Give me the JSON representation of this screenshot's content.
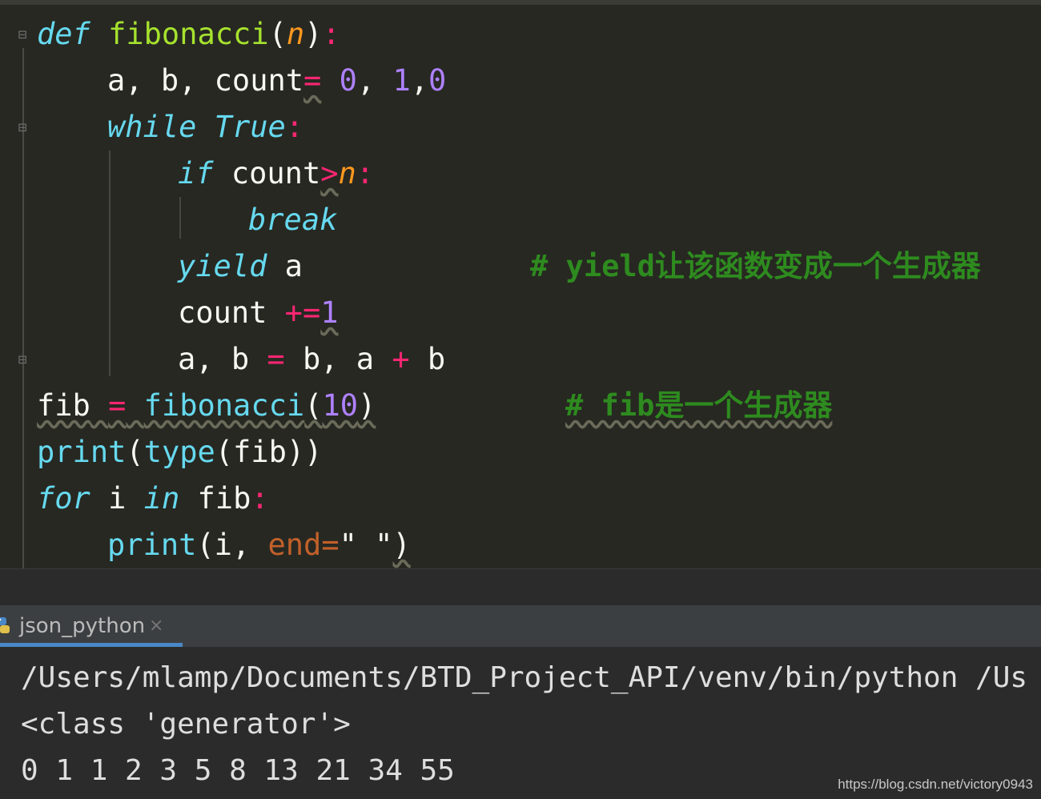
{
  "code": {
    "l1": {
      "kw": "def",
      "fn": "fibonacci",
      "open": "(",
      "param": "n",
      "close": ")",
      "colon": ":"
    },
    "l2": {
      "vars": "a, b, count",
      "eq": "=",
      "v0": "0",
      "c1": ", ",
      "v1": "1",
      "c2": ",",
      "v2": "0"
    },
    "l3": {
      "kw": "while",
      "val": "True",
      "colon": ":"
    },
    "l4": {
      "kw": "if",
      "var": "count",
      "op": ">",
      "param": "n",
      "colon": ":"
    },
    "l5": {
      "kw": "break"
    },
    "l6": {
      "kw": "yield",
      "var": "a",
      "comment": "# yield让该函数变成一个生成器"
    },
    "l7": {
      "var": "count",
      "op": "+=",
      "num": "1"
    },
    "l8": {
      "lhs": "a, b",
      "eq": "=",
      "rhs1": "b, a",
      "plus": "+",
      "rhs2": "b"
    },
    "l9": {
      "var": "fib",
      "eq": "=",
      "fn": "fibonacci",
      "open": "(",
      "num": "10",
      "close": ")",
      "comment": "# fib是一个生成器"
    },
    "l10": {
      "fn": "print",
      "open": "(",
      "fn2": "type",
      "inner": "(fib))"
    },
    "l11": {
      "kw": "for",
      "var": "i",
      "kw2": "in",
      "iter": "fib",
      "colon": ":"
    },
    "l12": {
      "fn": "print",
      "open": "(i, ",
      "kwarg": "end",
      "eq": "=",
      "str": "\" \"",
      "close": ")"
    }
  },
  "run_panel": {
    "tab_label": "json_python",
    "close": "×"
  },
  "console": {
    "line1": "/Users/mlamp/Documents/BTD_Project_API/venv/bin/python /Us",
    "line2": "<class 'generator'>",
    "line3": "0 1 1 2 3 5 8 13 21 34 55"
  },
  "watermark": "https://blog.csdn.net/victory0943",
  "colors": {
    "keyword": "#66d9ef",
    "function": "#a6e22e",
    "param": "#fd971f",
    "number": "#ae81ff",
    "operator": "#f92672",
    "comment": "#2e8b1f",
    "tab_underline": "#4a88c7"
  }
}
